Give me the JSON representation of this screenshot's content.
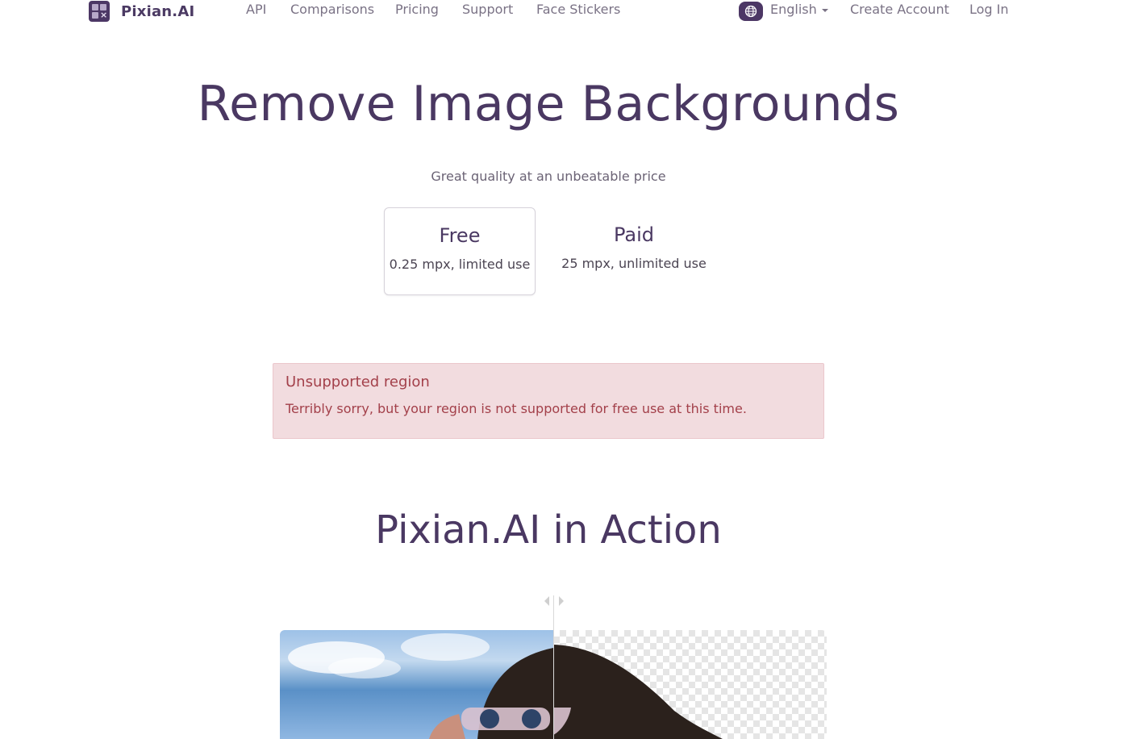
{
  "brand": {
    "name": "Pixian.AI"
  },
  "nav": {
    "links": [
      "API",
      "Comparisons",
      "Pricing",
      "Support",
      "Face Stickers"
    ],
    "language": "English",
    "create_account": "Create Account",
    "login": "Log In"
  },
  "hero": {
    "title": "Remove Image Backgrounds",
    "tagline": "Great quality at an unbeatable price"
  },
  "plans": [
    {
      "title": "Free",
      "subtitle": "0.25 mpx, limited use",
      "selected": true
    },
    {
      "title": "Paid",
      "subtitle": "25 mpx, unlimited use",
      "selected": false
    }
  ],
  "alert": {
    "title": "Unsupported region",
    "message": "Terribly sorry, but your region is not supported for free use at this time."
  },
  "demo": {
    "title": "Pixian.AI in Action"
  },
  "colors": {
    "brand": "#4a3862",
    "alert_bg": "#f2dcdf",
    "alert_text": "#a3404a"
  }
}
